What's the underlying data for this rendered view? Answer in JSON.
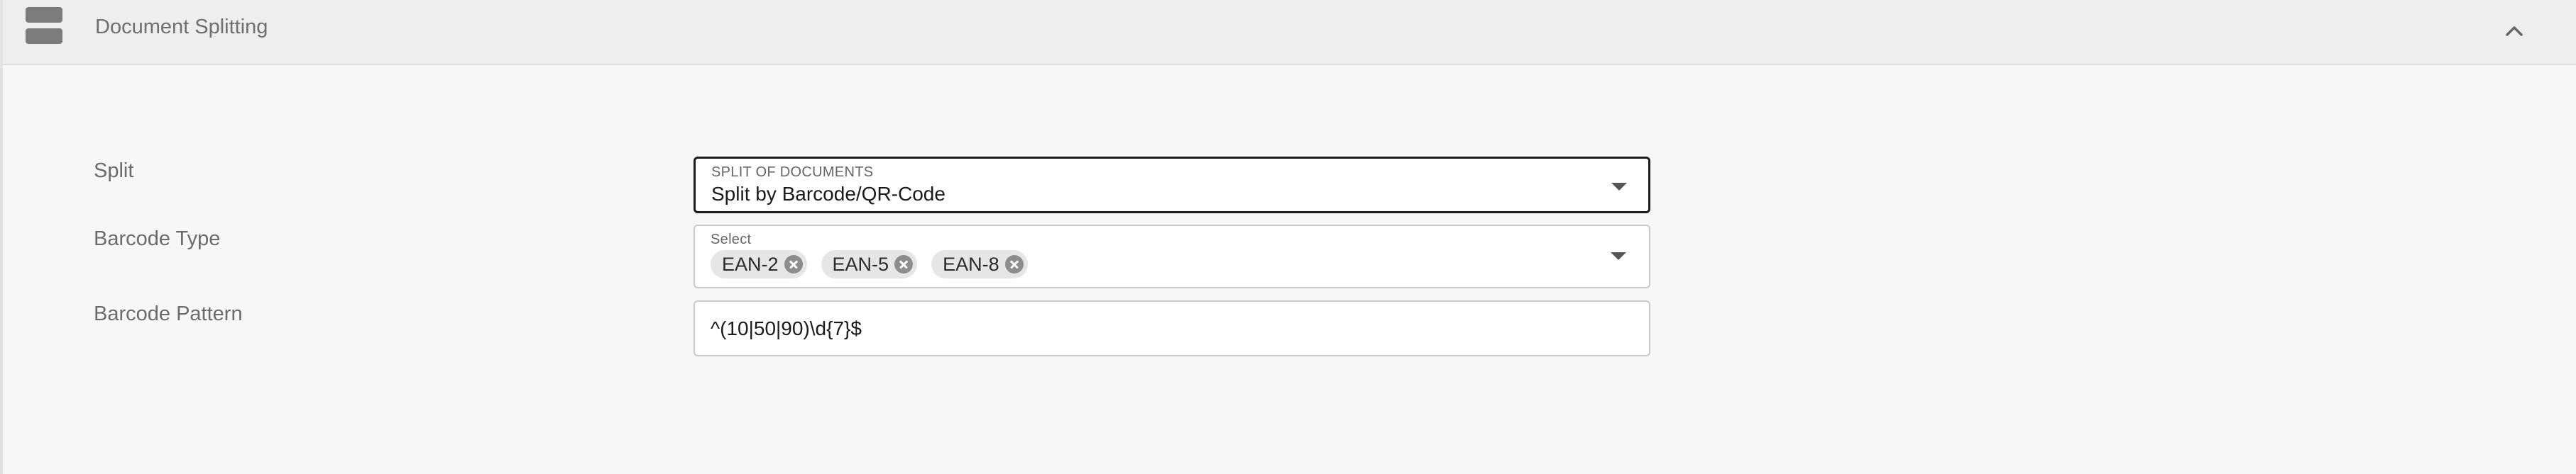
{
  "header": {
    "title": "Document Splitting",
    "icon": "panel-section-icon",
    "collapse_icon": "chevron-up-icon"
  },
  "form": {
    "split": {
      "label": "Split",
      "caption": "SPLIT OF DOCUMENTS",
      "value": "Split by Barcode/QR-Code"
    },
    "barcode_type": {
      "label": "Barcode Type",
      "caption": "Select",
      "chips": [
        "EAN-2",
        "EAN-5",
        "EAN-8"
      ]
    },
    "barcode_pattern": {
      "label": "Barcode Pattern",
      "value": "^(10|50|90)\\d{7}$"
    }
  }
}
